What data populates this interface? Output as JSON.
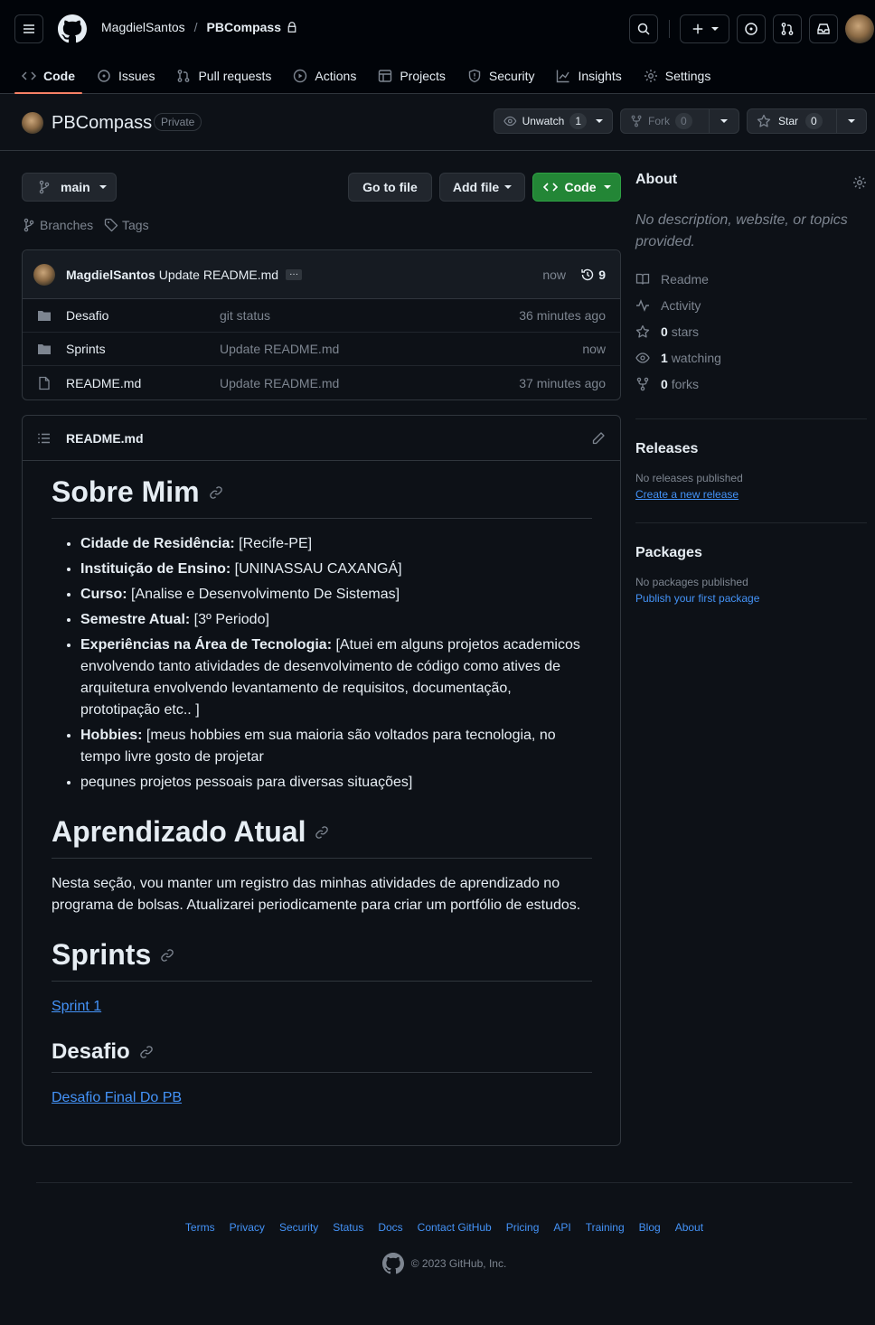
{
  "header": {
    "owner": "MagdielSantos",
    "separator": "/",
    "repo": "PBCompass"
  },
  "nav": [
    {
      "label": "Code",
      "icon": "code-icon",
      "active": true
    },
    {
      "label": "Issues",
      "icon": "issue-icon"
    },
    {
      "label": "Pull requests",
      "icon": "pull-request-icon"
    },
    {
      "label": "Actions",
      "icon": "play-icon"
    },
    {
      "label": "Projects",
      "icon": "table-icon"
    },
    {
      "label": "Security",
      "icon": "shield-icon"
    },
    {
      "label": "Insights",
      "icon": "graph-icon"
    },
    {
      "label": "Settings",
      "icon": "gear-icon"
    }
  ],
  "repo_header": {
    "name": "PBCompass",
    "visibility": "Private",
    "unwatch_label": "Unwatch",
    "watch_count": "1",
    "fork_label": "Fork",
    "fork_count": "0",
    "star_label": "Star",
    "star_count": "0"
  },
  "toolbar": {
    "branch": "main",
    "go_to_file": "Go to file",
    "add_file": "Add file",
    "code": "Code",
    "branches": "Branches",
    "tags": "Tags"
  },
  "commit": {
    "author": "MagdielSantos",
    "message": "Update README.md",
    "ellipsis": "···",
    "time": "now",
    "commit_count": "9"
  },
  "files": [
    {
      "name": "Desafio",
      "type": "folder",
      "message": "git status",
      "time": "36 minutes ago"
    },
    {
      "name": "Sprints",
      "type": "folder",
      "message": "Update README.md",
      "time": "now"
    },
    {
      "name": "README.md",
      "type": "file",
      "message": "Update README.md",
      "time": "37 minutes ago"
    }
  ],
  "readme": {
    "filename": "README.md",
    "h1_sobre": "Sobre Mim",
    "list": [
      {
        "label": "Cidade de Residência:",
        "text": " [Recife-PE]"
      },
      {
        "label": "Instituição de Ensino:",
        "text": " [UNINASSAU CAXANGÁ]"
      },
      {
        "label": "Curso:",
        "text": " [Analise e Desenvolvimento De Sistemas]"
      },
      {
        "label": "Semestre Atual:",
        "text": " [3º Periodo]"
      },
      {
        "label": "Experiências na Área de Tecnologia:",
        "text": " [Atuei em alguns projetos academicos envolvendo tanto atividades de desenvolvimento de código como atives de arquitetura envolvendo levantamento de requisitos, documentação, prototipação etc.. ]"
      },
      {
        "label": "Hobbies:",
        "text": " [meus hobbies em sua maioria são voltados para tecnologia, no tempo livre gosto de projetar"
      },
      {
        "label": "",
        "text": "pequnes projetos pessoais para diversas situações]"
      }
    ],
    "h1_aprendizado": "Aprendizado Atual",
    "aprendizado_text": "Nesta seção, vou manter um registro das minhas atividades de aprendizado no programa de bolsas. Atualizarei periodicamente para criar um portfólio de estudos.",
    "h1_sprints": "Sprints",
    "sprint_link": "Sprint 1",
    "h2_desafio": "Desafio",
    "desafio_link": "Desafio Final Do PB"
  },
  "about": {
    "title": "About",
    "description": "No description, website, or topics provided.",
    "readme": "Readme",
    "activity": "Activity",
    "stars_count": "0",
    "stars_label": "stars",
    "watching_count": "1",
    "watching_label": "watching",
    "forks_count": "0",
    "forks_label": "forks"
  },
  "releases": {
    "title": "Releases",
    "empty": "No releases published",
    "create_link": "Create a new release"
  },
  "packages": {
    "title": "Packages",
    "empty": "No packages published",
    "publish_link": "Publish your first package"
  },
  "footer": {
    "links": [
      "Terms",
      "Privacy",
      "Security",
      "Status",
      "Docs",
      "Contact GitHub",
      "Pricing",
      "API",
      "Training",
      "Blog",
      "About"
    ],
    "copyright": "© 2023 GitHub, Inc."
  },
  "colors": {
    "background": "#0d1117",
    "topbar": "#010409",
    "accent_green": "#238636",
    "link_blue": "#4493f8",
    "tab_underline": "#f78166"
  }
}
